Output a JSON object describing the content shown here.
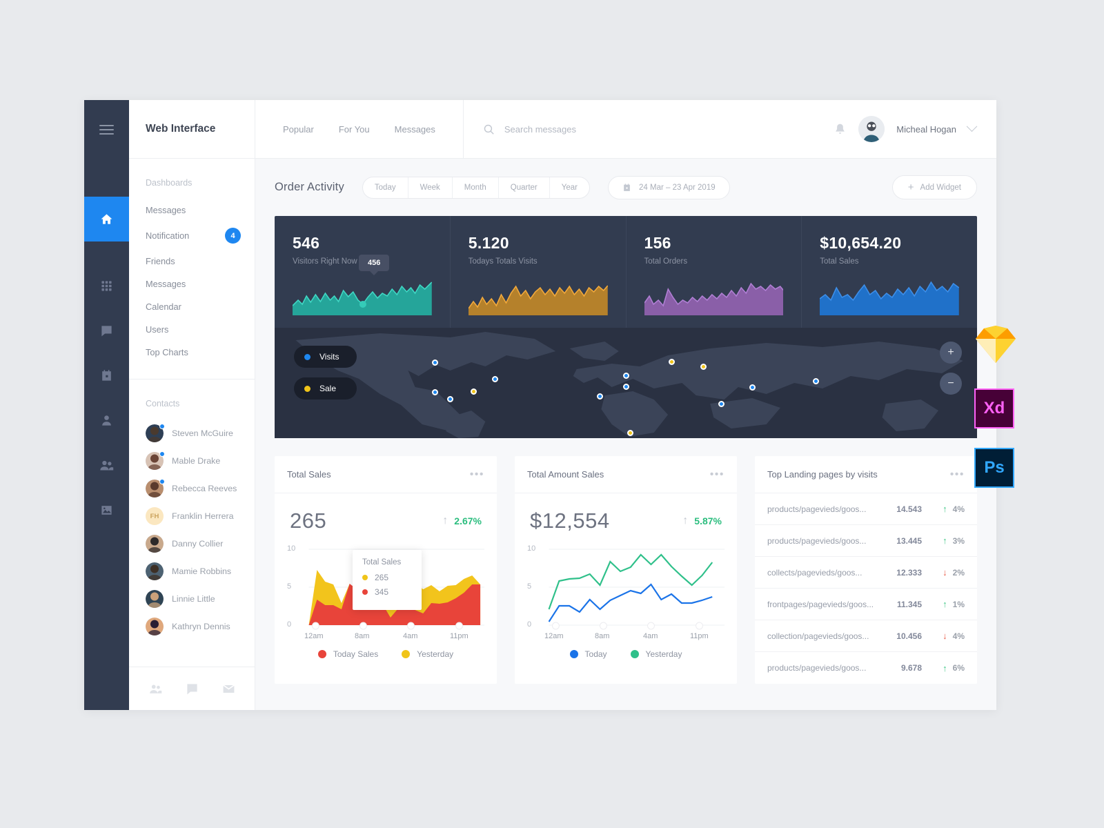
{
  "rail": {
    "burger_icon": "hamburger-icon",
    "items": [
      {
        "icon": "home-icon",
        "name": "home",
        "active": true
      },
      {
        "icon": "grid-icon",
        "name": "apps",
        "active": false
      },
      {
        "icon": "chat-icon",
        "name": "messages",
        "active": false
      },
      {
        "icon": "calendar-icon",
        "name": "calendar",
        "active": false
      },
      {
        "icon": "user-icon",
        "name": "profile",
        "active": false
      },
      {
        "icon": "users-icon",
        "name": "contacts",
        "active": false
      },
      {
        "icon": "image-icon",
        "name": "media",
        "active": false
      }
    ]
  },
  "sidebar": {
    "brand": "Web Interface",
    "dashboards_caption": "Dashboards",
    "nav_items": [
      {
        "label": "Messages",
        "badge": ""
      },
      {
        "label": "Notification",
        "badge": "4"
      },
      {
        "label": "Friends",
        "badge": ""
      },
      {
        "label": "Messages",
        "badge": ""
      },
      {
        "label": "Calendar",
        "badge": ""
      },
      {
        "label": "Users",
        "badge": ""
      },
      {
        "label": "Top Charts",
        "badge": ""
      }
    ],
    "contacts_caption": "Contacts",
    "contacts": [
      {
        "name": "Steven McGuire",
        "online": true,
        "initials": ""
      },
      {
        "name": "Mable Drake",
        "online": true,
        "initials": ""
      },
      {
        "name": "Rebecca Reeves",
        "online": true,
        "initials": ""
      },
      {
        "name": "Franklin Herrera",
        "online": false,
        "initials": "FH"
      },
      {
        "name": "Danny Collier",
        "online": false,
        "initials": ""
      },
      {
        "name": "Mamie Robbins",
        "online": false,
        "initials": ""
      },
      {
        "name": "Linnie Little",
        "online": false,
        "initials": ""
      },
      {
        "name": "Kathryn Dennis",
        "online": false,
        "initials": ""
      }
    ],
    "footer_icons": [
      "users-icon",
      "chat-icon",
      "mail-icon"
    ]
  },
  "topbar": {
    "tabs": [
      {
        "label": "Popular"
      },
      {
        "label": "For You"
      },
      {
        "label": "Messages"
      }
    ],
    "search_placeholder": "Search messages",
    "search_value": "",
    "search_icon": "search-icon",
    "bell_icon": "bell-icon",
    "user_name": "Micheal Hogan",
    "chevron_icon": "chevron-down-icon"
  },
  "toolbar": {
    "title": "Order Activity",
    "ranges": [
      "Today",
      "Week",
      "Month",
      "Quarter",
      "Year"
    ],
    "date_range": "24 Mar – 23 Apr 2019",
    "calendar_icon": "calendar-icon",
    "add_widget_label": "Add Widget",
    "plus_icon": "plus-icon"
  },
  "stats": [
    {
      "value": "546",
      "label": "Visitors Right Now",
      "color": "#25a59a",
      "tooltip": "456"
    },
    {
      "value": "5.120",
      "label": "Todays Totals Visits",
      "color": "#b5812b",
      "tooltip": ""
    },
    {
      "value": "156",
      "label": "Total Orders",
      "color": "#8a5fa8",
      "tooltip": ""
    },
    {
      "value": "$10,654.20",
      "label": "Total Sales",
      "color": "#2071c9",
      "tooltip": ""
    }
  ],
  "map": {
    "legend": [
      {
        "label": "Visits",
        "color": "#1e87f0"
      },
      {
        "label": "Sale",
        "color": "#f0c419"
      }
    ],
    "zoom_in": "+",
    "zoom_out": "−",
    "points": [
      {
        "x": 224,
        "y": 46,
        "type": "visits"
      },
      {
        "x": 309,
        "y": 70,
        "type": "visits"
      },
      {
        "x": 224,
        "y": 89,
        "type": "visits"
      },
      {
        "x": 246,
        "y": 99,
        "type": "visits"
      },
      {
        "x": 279,
        "y": 88,
        "type": "sale"
      },
      {
        "x": 459,
        "y": 95,
        "type": "visits"
      },
      {
        "x": 496,
        "y": 65,
        "type": "visits"
      },
      {
        "x": 496,
        "y": 81,
        "type": "visits"
      },
      {
        "x": 561,
        "y": 45,
        "type": "sale"
      },
      {
        "x": 606,
        "y": 52,
        "type": "sale"
      },
      {
        "x": 676,
        "y": 82,
        "type": "visits"
      },
      {
        "x": 502,
        "y": 148,
        "type": "sale"
      },
      {
        "x": 766,
        "y": 73,
        "type": "visits"
      },
      {
        "x": 632,
        "y": 106,
        "type": "visits"
      }
    ]
  },
  "chart_data": [
    {
      "type": "area",
      "title": "Total Sales",
      "kpi_value": "265",
      "delta": "2.67%",
      "delta_direction": "up",
      "xlabel": "",
      "ylabel": "",
      "ylim": [
        0,
        10
      ],
      "yticks": [
        "0",
        "5",
        "10"
      ],
      "categories": [
        "12am",
        "8am",
        "4am",
        "11pm"
      ],
      "tooltip": {
        "title": "Total Sales",
        "rows": [
          {
            "color": "#f0c419",
            "value": "265"
          },
          {
            "color": "#e8443a",
            "value": "345"
          }
        ]
      },
      "legend": [
        {
          "name": "Today Sales",
          "color": "#e8443a"
        },
        {
          "name": "Yesterday",
          "color": "#f0c419"
        }
      ],
      "series": [
        {
          "name": "Yesterday",
          "color": "#f0c419",
          "values": [
            0,
            7.3,
            5.8,
            5.4,
            2.9,
            5.5,
            3.7,
            5.4,
            5.1,
            5.5,
            4.6,
            5.5,
            4.4,
            5.6,
            4.7,
            5.3,
            4.5,
            5.2,
            5.3,
            6.1,
            6.6,
            5.4
          ]
        },
        {
          "name": "Today Sales",
          "color": "#e8443a",
          "values": [
            0,
            3.4,
            2.6,
            2.6,
            2.1,
            5.5,
            4.6,
            4.3,
            3.4,
            2.8,
            1.0,
            2.3,
            3.6,
            2.0,
            1.6,
            2.9,
            2.8,
            3.0,
            3.6,
            4.3,
            5.4,
            5.4
          ]
        }
      ]
    },
    {
      "type": "line",
      "title": "Total Amount Sales",
      "kpi_value": "$12,554",
      "delta": "5.87%",
      "delta_direction": "up",
      "xlabel": "",
      "ylabel": "",
      "ylim": [
        0,
        10
      ],
      "yticks": [
        "0",
        "5",
        "10"
      ],
      "categories": [
        "12am",
        "8am",
        "4am",
        "11pm"
      ],
      "legend": [
        {
          "name": "Today",
          "color": "#1a73e8"
        },
        {
          "name": "Yesterday",
          "color": "#2fc08a"
        }
      ],
      "series": [
        {
          "name": "Yesterday",
          "color": "#2fc08a",
          "values": [
            2.1,
            5.8,
            6.1,
            6.2,
            6.7,
            5.3,
            8.4,
            7.1,
            7.6,
            9.3,
            8.0,
            9.3,
            7.7,
            6.5,
            5.3,
            6.6,
            8.3
          ]
        },
        {
          "name": "Today",
          "color": "#1a73e8",
          "values": [
            0.5,
            2.5,
            2.5,
            1.7,
            3.4,
            2.1,
            3.3,
            3.9,
            4.5,
            4.2,
            5.4,
            3.4,
            4.1,
            2.9,
            2.9,
            3.3,
            3.7
          ]
        }
      ]
    },
    {
      "type": "table",
      "title": "Top Landing pages by visits",
      "columns": [
        "page",
        "visits",
        "change"
      ],
      "rows": [
        {
          "page": "products/pagevieds/goos...",
          "visits": "14.543",
          "change": "4%",
          "direction": "up"
        },
        {
          "page": "products/pagevieds/goos...",
          "visits": "13.445",
          "change": "3%",
          "direction": "up"
        },
        {
          "page": "collects/pagevieds/goos...",
          "visits": "12.333",
          "change": "2%",
          "direction": "down"
        },
        {
          "page": "frontpages/pagevieds/goos...",
          "visits": "11.345",
          "change": "1%",
          "direction": "up"
        },
        {
          "page": "collection/pagevieds/goos...",
          "visits": "10.456",
          "change": "4%",
          "direction": "down"
        },
        {
          "page": "products/pagevieds/goos...",
          "visits": "9.678",
          "change": "6%",
          "direction": "up"
        }
      ]
    }
  ],
  "card_menu_icon": "more-dots-icon",
  "floaters": [
    {
      "name": "sketch-logo",
      "label": ""
    },
    {
      "name": "adobe-xd-logo",
      "label": "Xd"
    },
    {
      "name": "photoshop-logo",
      "label": "Ps"
    }
  ]
}
